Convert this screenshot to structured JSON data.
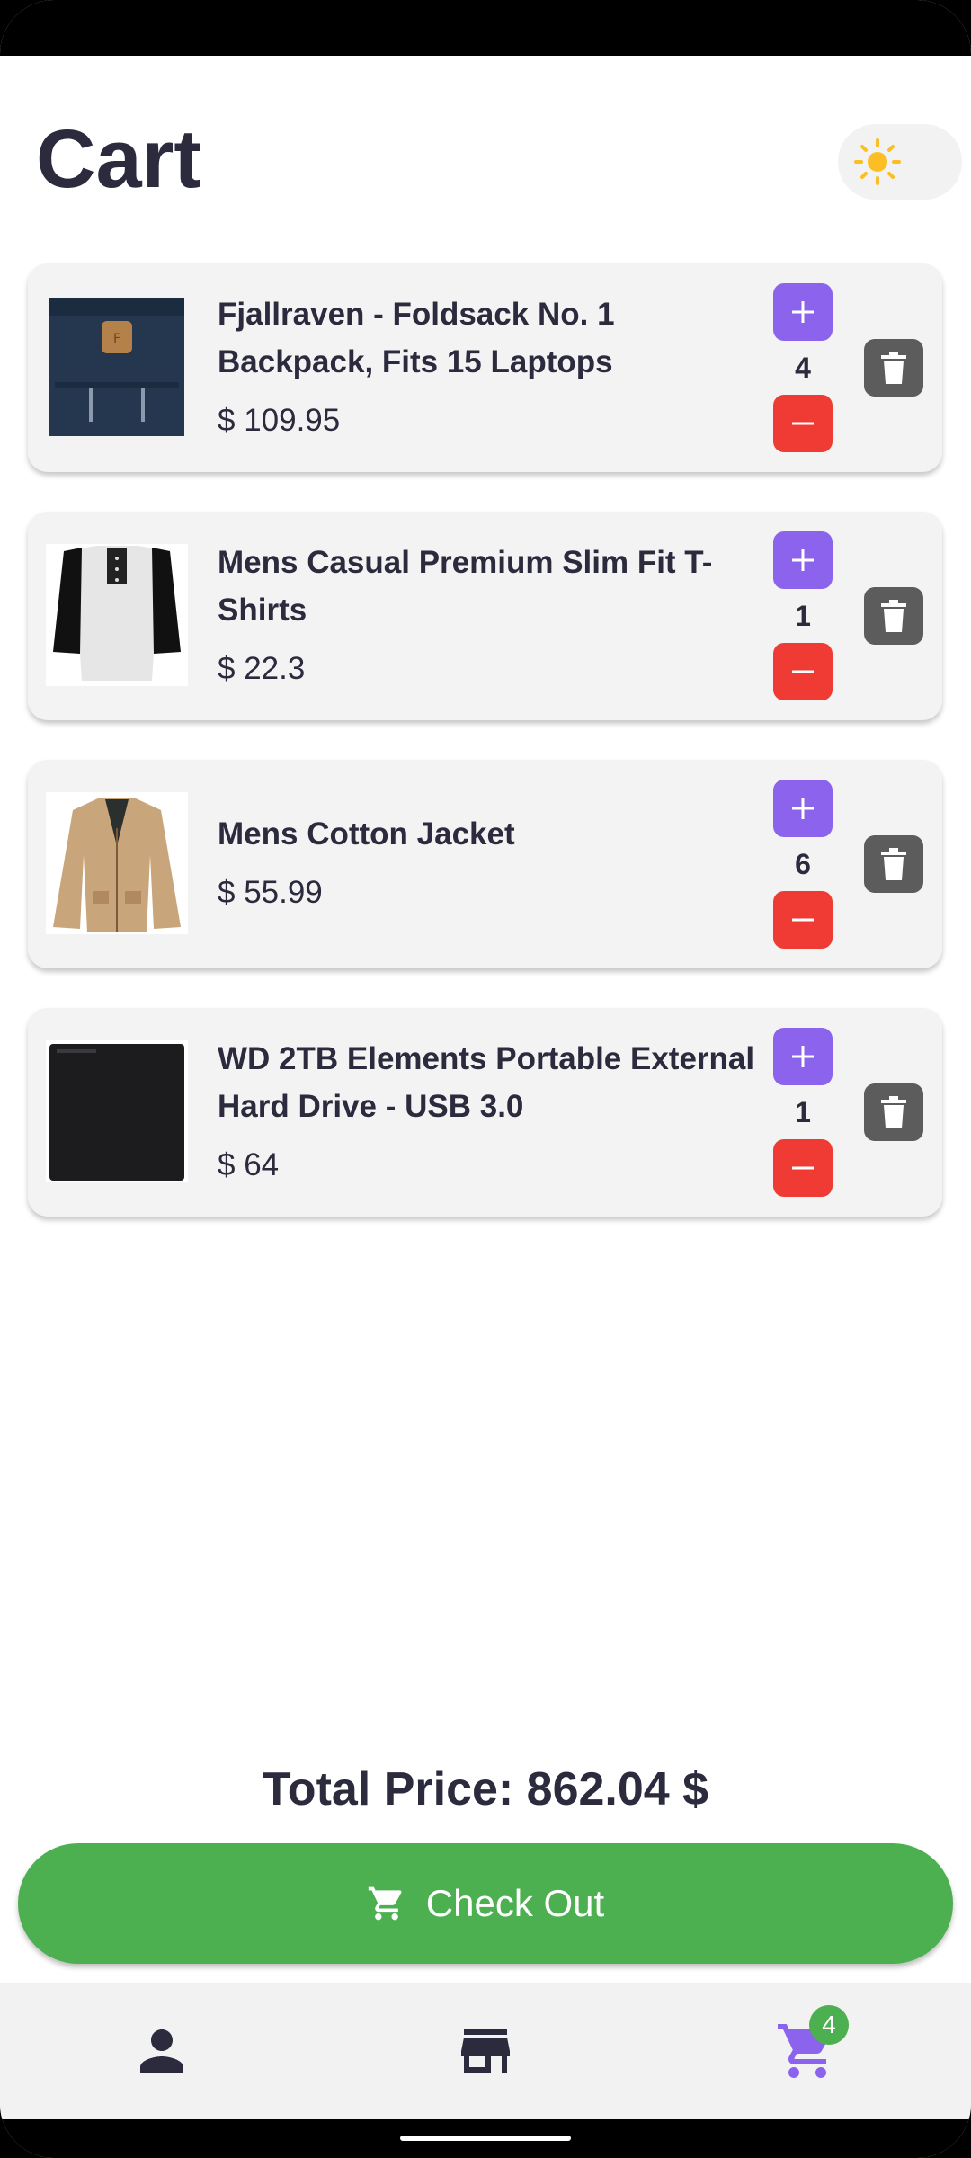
{
  "header": {
    "title": "Cart"
  },
  "theme_toggle": {
    "icon": "sun-icon",
    "accent": "#fbbf24"
  },
  "cart": {
    "items": [
      {
        "name": "Fjallraven - Foldsack No. 1 Backpack, Fits 15 Laptops",
        "price": "$ 109.95",
        "quantity": "4",
        "image": "backpack-image"
      },
      {
        "name": "Mens Casual Premium Slim Fit T-Shirts",
        "price": "$ 22.3",
        "quantity": "1",
        "image": "tshirt-image"
      },
      {
        "name": "Mens Cotton Jacket",
        "price": "$ 55.99",
        "quantity": "6",
        "image": "jacket-image"
      },
      {
        "name": "WD 2TB Elements Portable External Hard Drive - USB 3.0",
        "price": "$ 64",
        "quantity": "1",
        "image": "hard-drive-image"
      }
    ]
  },
  "total": {
    "label": "Total Price: 862.04 $"
  },
  "checkout": {
    "label": "Check Out",
    "color": "#4caf50"
  },
  "bottom_nav": {
    "items": [
      {
        "icon": "person-icon"
      },
      {
        "icon": "store-icon"
      },
      {
        "icon": "cart-icon",
        "badge": "4",
        "active": true
      }
    ]
  },
  "colors": {
    "plus": "#8b63ec",
    "minus": "#f03b35",
    "trash": "#5c5c5c",
    "text": "#2c2b3e",
    "active_nav": "#8b63ec"
  }
}
